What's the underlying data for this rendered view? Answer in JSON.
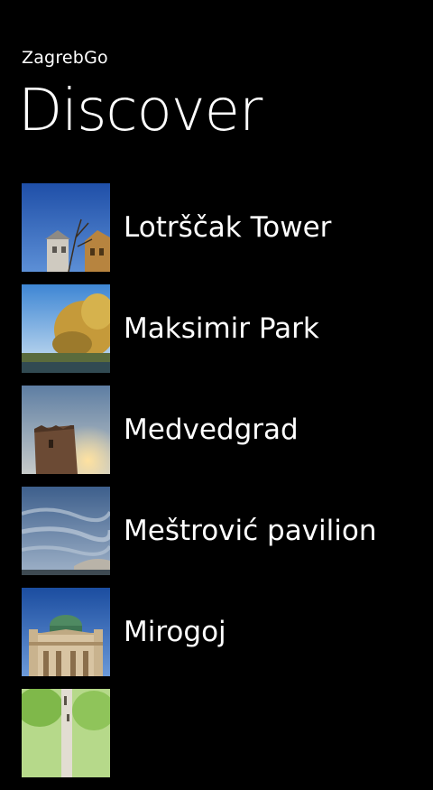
{
  "app": {
    "title": "ZagrebGo"
  },
  "page": {
    "title": "Discover"
  },
  "items": [
    {
      "label": "Lotrščak Tower",
      "thumbnail": "lotrscak-tower-photo"
    },
    {
      "label": "Maksimir Park",
      "thumbnail": "maksimir-park-photo"
    },
    {
      "label": "Medvedgrad",
      "thumbnail": "medvedgrad-photo"
    },
    {
      "label": "Meštrović pavilion",
      "thumbnail": "mestrovic-pavilion-photo"
    },
    {
      "label": "Mirogoj",
      "thumbnail": "mirogoj-photo"
    },
    {
      "label": "",
      "thumbnail": "park-trees-photo"
    }
  ],
  "colors": {
    "background": "#000000",
    "text": "#ffffff"
  }
}
